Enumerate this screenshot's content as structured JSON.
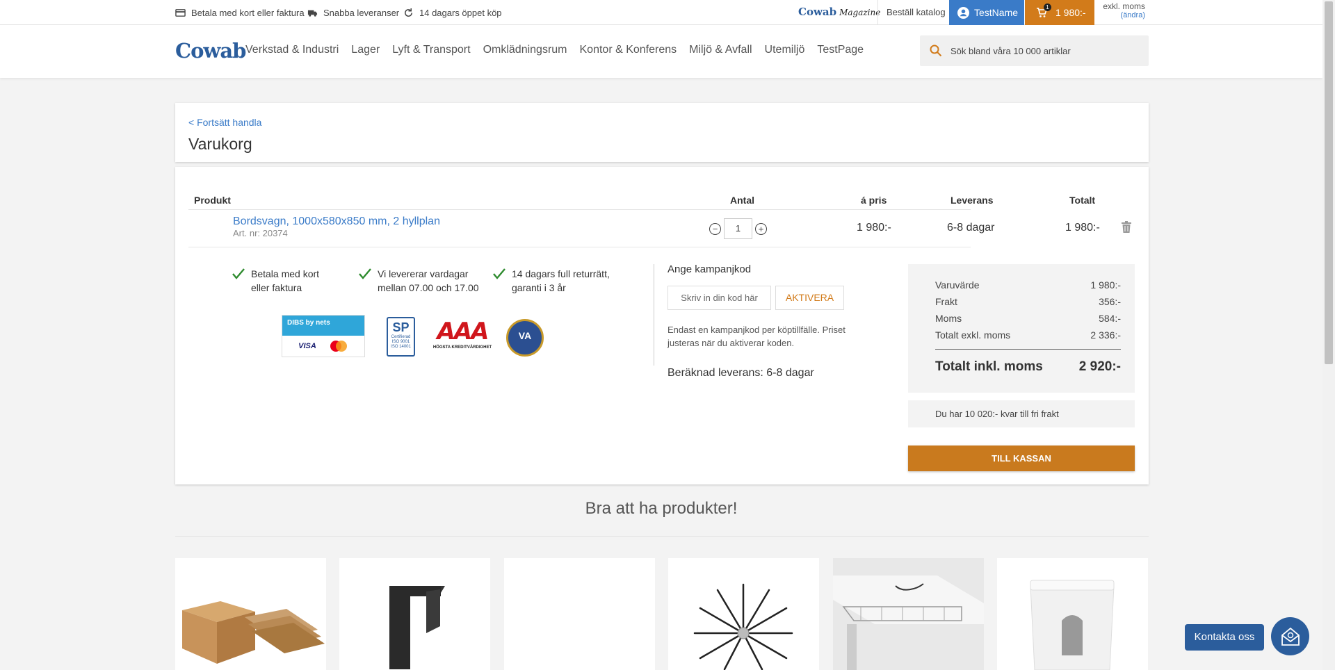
{
  "topbar": {
    "usps": [
      "Betala med kort eller faktura",
      "Snabba leveranser",
      "14 dagars öppet köp"
    ],
    "magazine_brand": "Cowab",
    "magazine_word": "Magazine",
    "catalog": "Beställ katalog",
    "user_name": "TestName",
    "cart_count": "1",
    "cart_total": "1 980:-",
    "vat_mode": "exkl. moms",
    "vat_change": "(ändra)"
  },
  "header": {
    "logo": "Cowab",
    "nav": [
      "Verkstad & Industri",
      "Lager",
      "Lyft & Transport",
      "Omklädningsrum",
      "Kontor & Konferens",
      "Miljö & Avfall",
      "Utemiljö",
      "TestPage"
    ],
    "search_placeholder": "Sök bland våra 10 000 artiklar"
  },
  "cart": {
    "back_link": "< Fortsätt handla",
    "title": "Varukorg",
    "columns": {
      "product": "Produkt",
      "qty": "Antal",
      "price": "á pris",
      "delivery": "Leverans",
      "total": "Totalt"
    },
    "item": {
      "name": "Bordsvagn, 1000x580x850 mm, 2 hyllplan",
      "art_nr": "Art. nr: 20374",
      "qty": "1",
      "price": "1 980:-",
      "delivery": "6-8 dagar",
      "total": "1 980:-"
    }
  },
  "trust": {
    "checks": [
      "Betala med kort eller faktura",
      "Vi levererar vardagar mellan 07.00 och 17.00",
      "14 dagars full returrätt, garanti i 3 år"
    ],
    "logos": [
      "DIBS by nets",
      "SP Certifierad",
      "AAA Högsta kreditvärdighet",
      "VA"
    ]
  },
  "campaign": {
    "title": "Ange kampanjkod",
    "placeholder": "Skriv in din kod här",
    "button": "AKTIVERA",
    "note": "Endast en kampanjkod per köptillfälle. Priset justeras när du aktiverar koden.",
    "estimated_delivery": "Beräknad leverans: 6-8 dagar"
  },
  "summary": {
    "rows": [
      {
        "label": "Varuvärde",
        "value": "1 980:-"
      },
      {
        "label": "Frakt",
        "value": "356:-"
      },
      {
        "label": "Moms",
        "value": "584:-"
      },
      {
        "label": "Totalt exkl. moms",
        "value": "2 336:-"
      }
    ],
    "total_label": "Totalt inkl. moms",
    "total_value": "2 920:-",
    "free_shipping": "Du har 10 020:- kvar till fri frakt",
    "checkout": "TILL KASSAN"
  },
  "related": {
    "title": "Bra att ha produkter!"
  },
  "contact": {
    "label": "Kontakta oss"
  },
  "colors": {
    "brand_blue": "#2b5d9c",
    "link_blue": "#3a7bc8",
    "accent_orange": "#d27b1a",
    "check_green": "#2e8b2e"
  }
}
